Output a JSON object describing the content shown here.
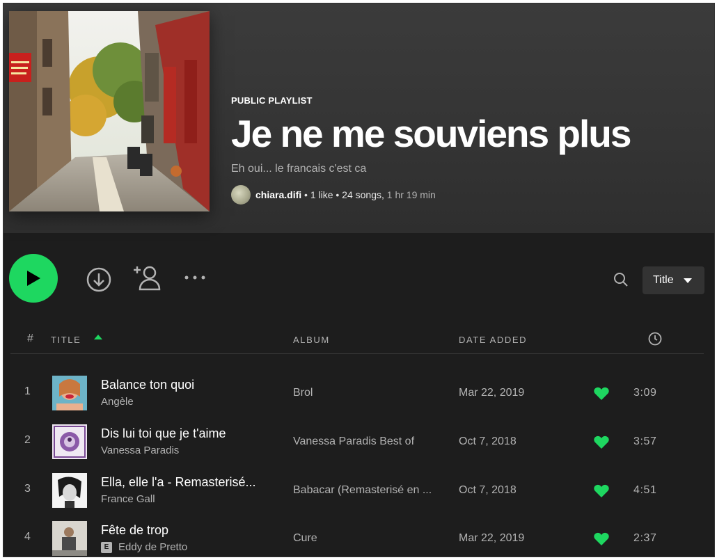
{
  "colors": {
    "accent": "#1ed760",
    "background": "#1d1d1d",
    "header_background": "#383838",
    "text_secondary": "#b3b3b3"
  },
  "playlist": {
    "type_label": "PUBLIC PLAYLIST",
    "title": "Je ne me souviens plus",
    "description": "Eh oui... le francais c'est ca",
    "owner": "chiara.difi",
    "stats": " • 1 like • 24 songs, ",
    "duration": "1 hr 19 min"
  },
  "actions": {
    "play_icon": "play-icon",
    "download_icon": "download-icon",
    "add_user_icon": "add-user-icon",
    "more_icon": "more-icon",
    "search_icon": "search-icon",
    "sort_label": "Title"
  },
  "columns": {
    "hash": "#",
    "title": "TITLE",
    "album": "ALBUM",
    "date_added": "DATE ADDED",
    "duration_icon": "clock-icon"
  },
  "tracks": [
    {
      "num": "1",
      "title": "Balance ton quoi",
      "artist": "Angèle",
      "explicit": false,
      "album": "Brol",
      "date_added": "Mar 22, 2019",
      "liked": true,
      "duration": "3:09"
    },
    {
      "num": "2",
      "title": "Dis lui toi que je t'aime",
      "artist": "Vanessa Paradis",
      "explicit": false,
      "album": "Vanessa Paradis Best of",
      "date_added": "Oct 7, 2018",
      "liked": true,
      "duration": "3:57"
    },
    {
      "num": "3",
      "title": "Ella, elle l'a - Remasterisé...",
      "artist": "France Gall",
      "explicit": false,
      "album": "Babacar (Remasterisé en ...",
      "date_added": "Oct 7, 2018",
      "liked": true,
      "duration": "4:51"
    },
    {
      "num": "4",
      "title": "Fête de trop",
      "artist": "Eddy de Pretto",
      "explicit": true,
      "explicit_label": "E",
      "album": "Cure",
      "date_added": "Mar 22, 2019",
      "liked": true,
      "duration": "2:37"
    }
  ]
}
